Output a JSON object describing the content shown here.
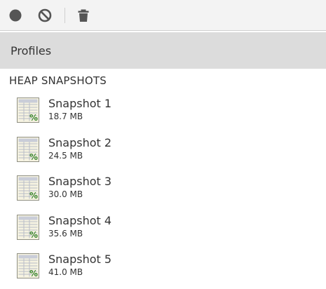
{
  "toolbar": {
    "record_icon": "record-icon",
    "clear_icon": "clear-icon",
    "trash_icon": "trash-icon"
  },
  "sidebar": {
    "header": "Profiles",
    "section_title": "HEAP SNAPSHOTS",
    "snapshots": [
      {
        "name": "Snapshot 1",
        "size": "18.7 MB"
      },
      {
        "name": "Snapshot 2",
        "size": "24.5 MB"
      },
      {
        "name": "Snapshot 3",
        "size": "30.0 MB"
      },
      {
        "name": "Snapshot 4",
        "size": "35.6 MB"
      },
      {
        "name": "Snapshot 5",
        "size": "41.0 MB"
      }
    ]
  },
  "colors": {
    "toolbar_bg": "#f3f3f3",
    "header_bg": "#dcdcdc",
    "icon_dark": "#555555"
  }
}
